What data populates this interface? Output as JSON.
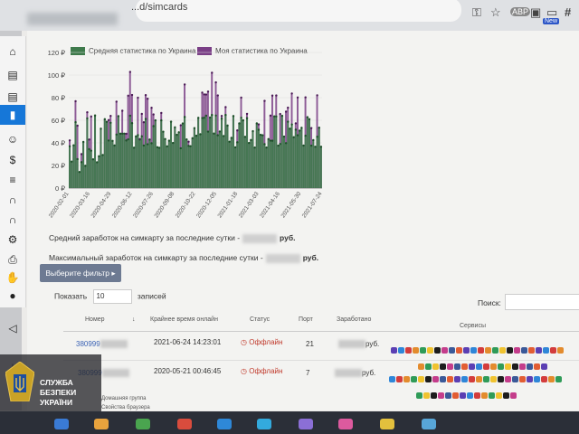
{
  "browser": {
    "url": "...d/simcards",
    "toolbar_icons": [
      "key-icon",
      "star-icon",
      "extension-icon",
      "cube-icon",
      "tab-icon",
      "hash-icon"
    ],
    "extension_badge": "New"
  },
  "sidebar": {
    "icons": [
      "home-icon",
      "document-icon",
      "document-icon",
      "sim-card-icon",
      "person-icon",
      "dollar-icon",
      "sort-icon",
      "magnet-icon",
      "magnet-icon",
      "gear-icon",
      "print-icon",
      "hand-icon",
      "globe-icon",
      "send-icon",
      "pin-icon"
    ]
  },
  "chart_data": {
    "type": "area",
    "series": [
      {
        "name": "Средняя статистика по Украина",
        "color": "#3e7a4b"
      },
      {
        "name": "Моя статистика по Украина",
        "color": "#7a3f86"
      }
    ],
    "ylim": [
      0,
      120
    ],
    "yticks": [
      "0 ₽",
      "20 ₽",
      "40 ₽",
      "60 ₽",
      "80 ₽",
      "100 ₽",
      "120 ₽"
    ],
    "xticks": [
      "2020-02-01",
      "2020-03-16",
      "2020-04-29",
      "2020-06-12",
      "2020-07-26",
      "2020-09-08",
      "2020-10-22",
      "2020-12-05",
      "2021-01-18",
      "2021-03-03",
      "2021-04-16",
      "2021-05-30",
      "2021-07-24"
    ]
  },
  "stats": {
    "avg_label": "Средний заработок на симкарту за последние сутки -",
    "max_label": "Максимальный заработок на симкарту за последние сутки -",
    "currency": "руб."
  },
  "filter_button": "Выберите фильтр ▸",
  "table_controls": {
    "show_label": "Показать",
    "page_length": "10",
    "entries_label": "записей",
    "search_label": "Поиск:"
  },
  "table": {
    "columns": [
      "Номер",
      "Крайнее время онлайн",
      "Статус",
      "Порт",
      "Заработано",
      "Сервисы"
    ],
    "rows": [
      {
        "number": "380999",
        "last_online": "2021-06-24 14:23:01",
        "status": "Оффлайн",
        "port": "21",
        "earned": "руб."
      },
      {
        "number": "380999",
        "last_online": "2020-05-21 00:46:45",
        "status": "Оффлайн",
        "port": "7",
        "earned": "руб."
      }
    ]
  },
  "context_menu": [
    "Домашняя группа",
    "Свойства браузера"
  ],
  "overlay": {
    "line1": "СЛУЖБА",
    "line2": "БЕЗПЕКИ",
    "line3": "УКРАЇНИ"
  }
}
